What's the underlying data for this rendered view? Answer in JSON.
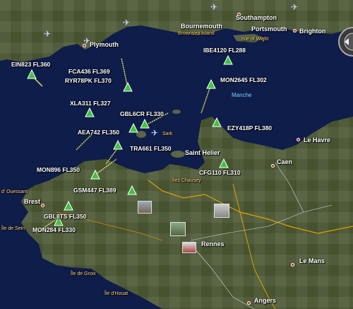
{
  "map": {
    "sea_label": "Manche",
    "cities": [
      {
        "key": "bournemouth",
        "name": "Bournemouth"
      },
      {
        "key": "southampton",
        "name": "Southampton"
      },
      {
        "key": "portsmouth",
        "name": "Portsmouth"
      },
      {
        "key": "brighton",
        "name": "Brighton"
      },
      {
        "key": "plymouth",
        "name": "Plymouth"
      },
      {
        "key": "le-havre",
        "name": "Le Havre"
      },
      {
        "key": "caen",
        "name": "Caen"
      },
      {
        "key": "saint-helier",
        "name": "Saint Helier"
      },
      {
        "key": "brest",
        "name": "Brest"
      },
      {
        "key": "rennes",
        "name": "Rennes"
      },
      {
        "key": "le-mans",
        "name": "Le Mans"
      },
      {
        "key": "angers",
        "name": "Angers"
      }
    ],
    "places": [
      {
        "key": "brownsea-island",
        "name": "Brownsea Island"
      },
      {
        "key": "isle-of-wight",
        "name": "Isle of Wight"
      },
      {
        "key": "sark",
        "name": "Sark"
      },
      {
        "key": "iles-chausey",
        "name": "Îles Chausey"
      },
      {
        "key": "ouessant",
        "name": "d' Ouessant"
      },
      {
        "key": "ile-de-sein",
        "name": "Île de Sein"
      },
      {
        "key": "ile-de-groix",
        "name": "Île de Groix"
      },
      {
        "key": "ile-d-houat",
        "name": "Île d'Houat"
      }
    ],
    "flights": [
      {
        "key": "ein823",
        "callsign": "EIN823",
        "level": "FL360",
        "text": "EIN823 FL360"
      },
      {
        "key": "fca436",
        "callsign": "FCA436",
        "level": "FL369",
        "text": "FCA436 FL369"
      },
      {
        "key": "ryr78pk",
        "callsign": "RYR78PK",
        "level": "FL370",
        "text": "RYR78PK FL370"
      },
      {
        "key": "ibe4120",
        "callsign": "IBE4120",
        "level": "FL288",
        "text": "IBE4120 FL288"
      },
      {
        "key": "mon2645",
        "callsign": "MON2645",
        "level": "FL302",
        "text": "MON2645 FL302"
      },
      {
        "key": "xla311",
        "callsign": "XLA311",
        "level": "FL327",
        "text": "XLA311 FL327"
      },
      {
        "key": "gbl6cr",
        "callsign": "GBL6CR",
        "level": "FL330",
        "text": "GBL6CR FL330"
      },
      {
        "key": "aea742",
        "callsign": "AEA742",
        "level": "FL350",
        "text": "AEA742 FL350"
      },
      {
        "key": "ezy418p",
        "callsign": "EZY418P",
        "level": "FL380",
        "text": "EZY418P FL380"
      },
      {
        "key": "tra661",
        "callsign": "TRA661",
        "level": "FL350",
        "text": "TRA661 FL350"
      },
      {
        "key": "mon896",
        "callsign": "MON896",
        "level": "FL350",
        "text": "MON896 FL350"
      },
      {
        "key": "cfg110",
        "callsign": "CFG110",
        "level": "FL310",
        "text": "CFG110 FL310"
      },
      {
        "key": "gsm447",
        "callsign": "GSM447",
        "level": "FL389",
        "text": "GSM447 FL389"
      },
      {
        "key": "gbl8ts",
        "callsign": "GBL8TS",
        "level": "FL350",
        "text": "GBL8TS FL350"
      },
      {
        "key": "mon284",
        "callsign": "MON284",
        "level": "FL330",
        "text": "MON284 FL330"
      }
    ],
    "colors": {
      "sea": "#0f1d4a",
      "land": "#4f5a3a",
      "flight_marker": "#3ec43e",
      "city_dot": "#d02020",
      "sea_label": "#7fd0ff",
      "road": "#e0e060",
      "border": "#e0a000"
    },
    "icons": {
      "airport": "airplane-icon",
      "flight": "triangle-marker-icon",
      "photo": "photo-thumbnail-icon",
      "navigation": "nav-ring-icon"
    }
  }
}
